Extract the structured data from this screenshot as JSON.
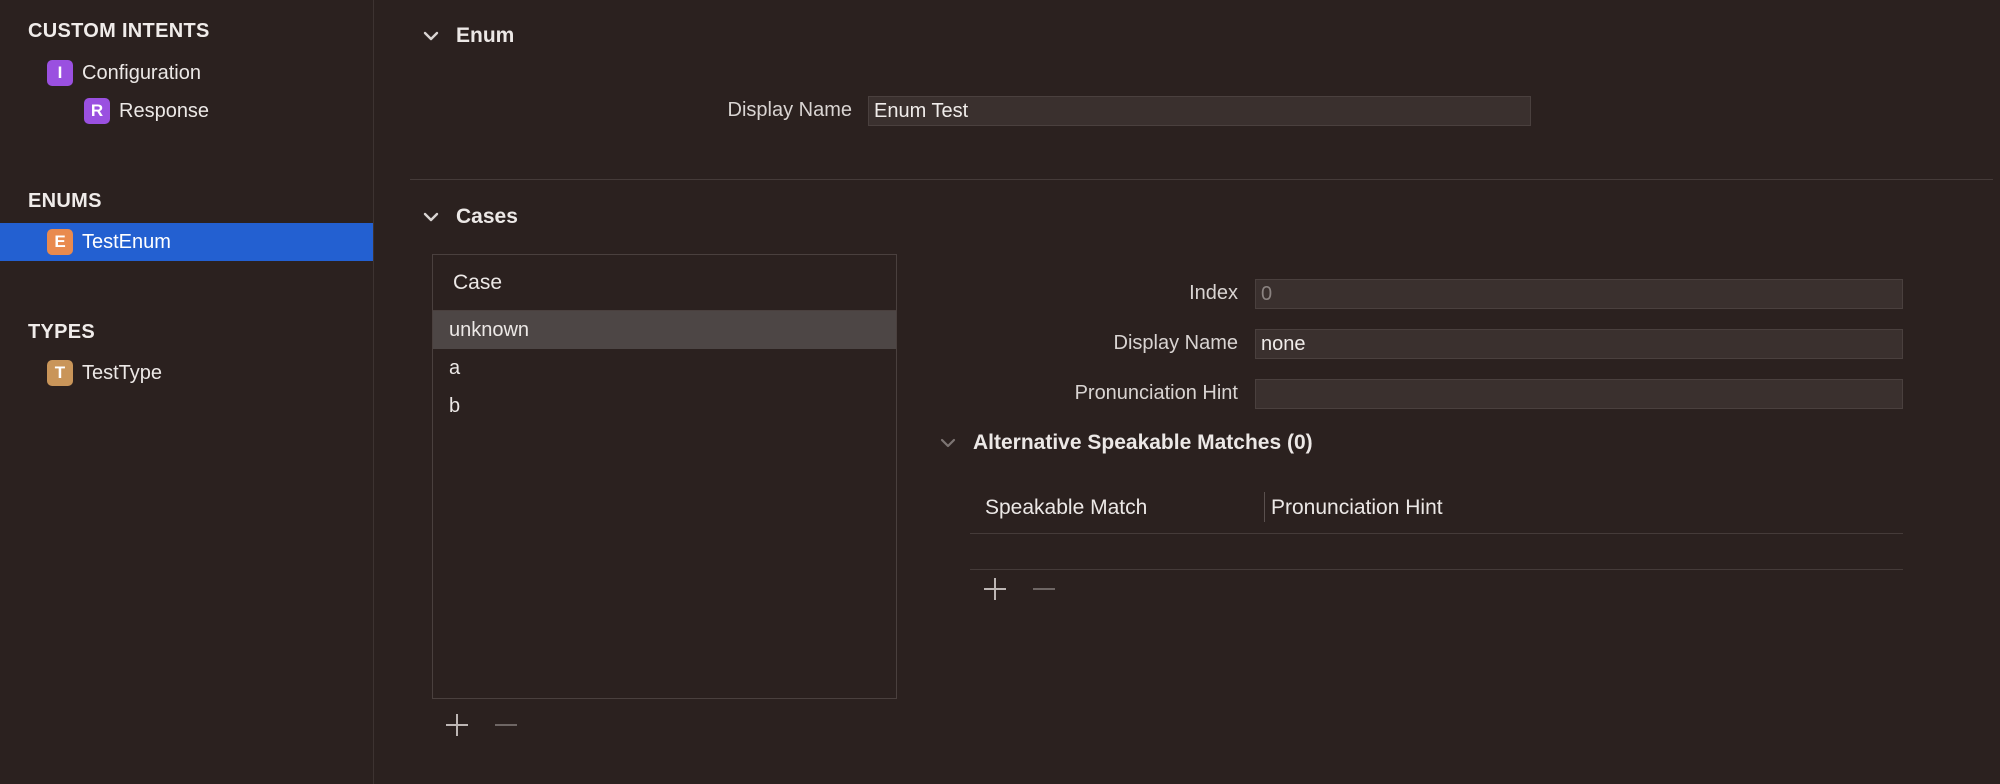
{
  "sidebar": {
    "custom_intents": {
      "header": "CUSTOM INTENTS",
      "items": [
        {
          "badge": "I",
          "label": "Configuration"
        },
        {
          "badge": "R",
          "label": "Response"
        }
      ]
    },
    "enums": {
      "header": "ENUMS",
      "items": [
        {
          "badge": "E",
          "label": "TestEnum"
        }
      ]
    },
    "types": {
      "header": "TYPES",
      "items": [
        {
          "badge": "T",
          "label": "TestType"
        }
      ]
    }
  },
  "enum_section": {
    "title": "Enum",
    "display_name_label": "Display Name",
    "display_name_value": "Enum Test"
  },
  "cases_section": {
    "title": "Cases",
    "list_header": "Case",
    "cases": [
      "unknown",
      "a",
      "b"
    ],
    "detail": {
      "index_label": "Index",
      "index_value": "0",
      "display_name_label": "Display Name",
      "display_name_value": "none",
      "pronunciation_label": "Pronunciation Hint",
      "pronunciation_value": ""
    },
    "alt_matches": {
      "title": "Alternative Speakable Matches (0)",
      "columns": [
        "Speakable Match",
        "Pronunciation Hint"
      ]
    }
  },
  "colors": {
    "background": "#2b211f",
    "selection": "#2360d1",
    "intent_badge": "#9a50e0",
    "enum_badge": "#e98a4e",
    "type_badge": "#c99559"
  }
}
